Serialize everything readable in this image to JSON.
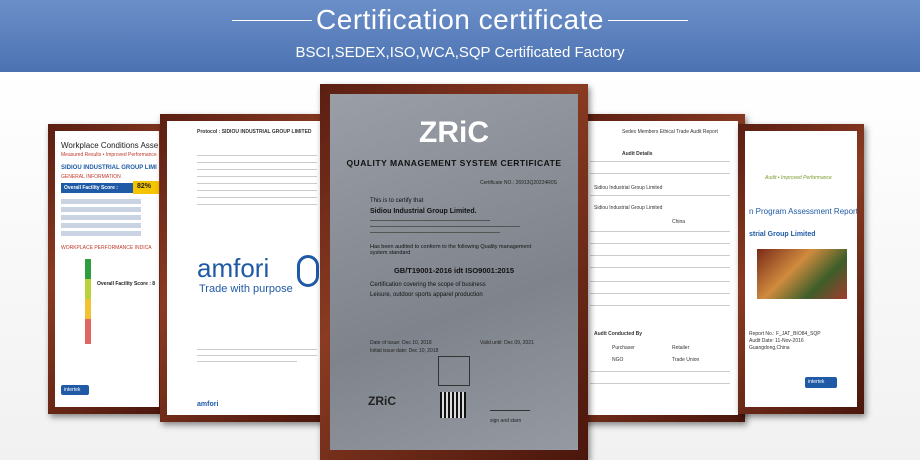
{
  "header": {
    "title": "Certification certificate",
    "subtitle": "BSCI,SEDEX,ISO,WCA,SQP Certificated Factory"
  },
  "cert_workplace": {
    "heading": "Workplace Conditions Asse",
    "sub": "Measured Results • Improved Performance",
    "company": "SIDIOU INDUSTRIAL GROUP LIMI",
    "general": "GENERAL INFORMATION",
    "score_label": "Overall Facility Score :",
    "score": "82%",
    "perf": "WORKPLACE PERFORMANCE INDICA",
    "score2": "Overall Facility Score : 8",
    "brand": "intertek"
  },
  "cert_amfori": {
    "protocol": "Protocol : SIDIOU INDUSTRIAL GROUP LIMITED",
    "logo": "amfori",
    "tagline": "Trade with purpose",
    "footer": "amfori"
  },
  "cert_zric": {
    "logo": "ZRiC",
    "title": "QUALITY MANAGEMENT SYSTEM CERTIFICATE",
    "cert_no": "Certificate NO.: 26913Q20224R0S",
    "certify": "This is to certify that",
    "company": "Sidiou Industrial Group Limited.",
    "audited": "Has been audited to conform to the following Quality management system standard",
    "standard": "GB/T19001-2016 idt ISO9001:2015",
    "scope_label": "Certification covering the scope of business",
    "scope": "Leisure, outdoor sports apparel production",
    "issue": "Date of issue: Dec 10, 2018",
    "valid": "Valid until: Dec 09, 2021",
    "initial": "Initial issue date: Dec 10, 2018",
    "bottom_logo": "ZRiC",
    "sign": "sign and stam"
  },
  "cert_sedex": {
    "title": "Sedex Members Ethical Trade Audit Report",
    "audit_details": "Audit Details",
    "company": "Sidiou Industrial Group Limited",
    "company2": "Sidiou Industrial Group Limited",
    "country": "China",
    "conducted": "Audit Conducted By",
    "purchaser": "Purchaser",
    "retailer": "Retailer",
    "ngo": "NGO",
    "trade_union": "Trade Union"
  },
  "cert_intertek": {
    "perf": "Audit • Improved Performance",
    "program": "n Program Assessment Report",
    "company": "strial Group Limited",
    "report_no": "Report No.: F_JAT_BIO84_SQP",
    "date": "Audit Date: 11-Nov-2016",
    "loc": "Guangdong,China",
    "brand": "intertek"
  }
}
